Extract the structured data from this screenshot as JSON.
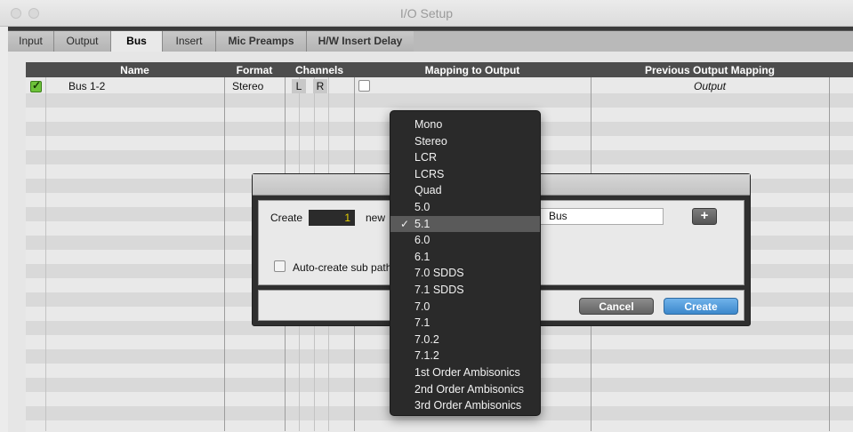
{
  "window": {
    "title": "I/O Setup"
  },
  "tabs": [
    {
      "label": "Input"
    },
    {
      "label": "Output"
    },
    {
      "label": "Bus"
    },
    {
      "label": "Insert"
    },
    {
      "label": "Mic Preamps"
    },
    {
      "label": "H/W Insert Delay"
    }
  ],
  "grid": {
    "columns": {
      "name": "Name",
      "format": "Format",
      "channels": "Channels",
      "mapping": "Mapping to Output",
      "previous": "Previous Output Mapping"
    },
    "rows": [
      {
        "enabled": true,
        "name": "Bus 1-2",
        "format": "Stereo",
        "channels": [
          "L",
          "R"
        ],
        "mapping_checked": false,
        "previous": "Output"
      }
    ]
  },
  "dialog": {
    "create_label": "Create",
    "count_value": "1",
    "new_label": "new",
    "name_value": "Bus",
    "plus_label": "+",
    "auto_create_label": "Auto-create sub paths",
    "auto_create_checked": false,
    "cancel_label": "Cancel",
    "create_button_label": "Create"
  },
  "format_menu": {
    "selected": "5.1",
    "check_glyph": "✓",
    "items": [
      "Mono",
      "Stereo",
      "LCR",
      "LCRS",
      "Quad",
      "5.0",
      "5.1",
      "6.0",
      "6.1",
      "7.0 SDDS",
      "7.1 SDDS",
      "7.0",
      "7.1",
      "7.0.2",
      "7.1.2",
      "1st Order Ambisonics",
      "2nd Order Ambisonics",
      "3rd Order Ambisonics"
    ]
  },
  "colors": {
    "accent_blue": "#4a90d9",
    "checkbox_green": "#6dc23a",
    "counter_yellow": "#e8d200"
  }
}
